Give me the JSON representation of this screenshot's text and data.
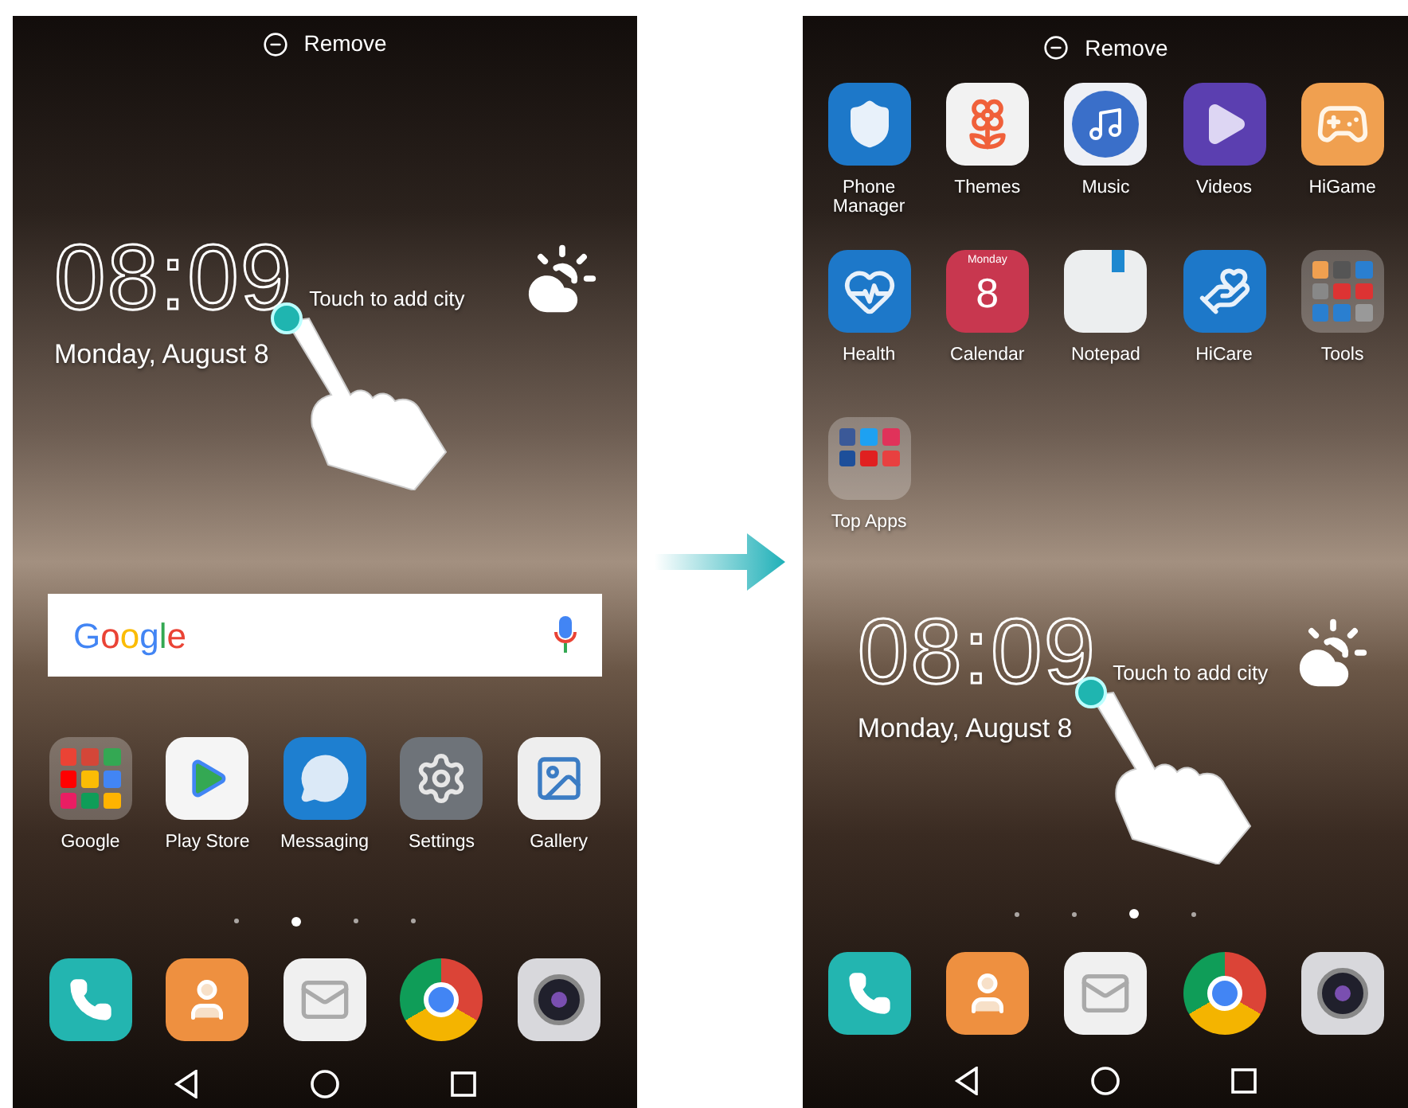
{
  "screens": [
    {
      "remove": "Remove",
      "sections": [
        {
          "kind": "clock",
          "time": "08:09",
          "hint": "Touch to add city",
          "date": "Monday, August 8"
        },
        {
          "kind": "search",
          "logo": "Google"
        },
        {
          "kind": "apps",
          "apps": [
            {
              "label": "Google"
            },
            {
              "label": "Play Store"
            },
            {
              "label": "Messaging"
            },
            {
              "label": "Settings"
            },
            {
              "label": "Gallery"
            }
          ]
        }
      ],
      "pages": [
        {
          "selected": false
        },
        {
          "selected": true
        },
        {
          "selected": false
        },
        {
          "selected": false
        }
      ]
    },
    {
      "remove": "Remove",
      "sections": [
        {
          "kind": "apps",
          "apps": [
            {
              "label": "Phone Manager"
            },
            {
              "label": "Themes"
            },
            {
              "label": "Music"
            },
            {
              "label": "Videos"
            },
            {
              "label": "HiGame"
            },
            {
              "label": "Health"
            },
            {
              "label": "Calendar",
              "icon_text": {
                "day": "Monday",
                "date": "8"
              }
            },
            {
              "label": "Notepad"
            },
            {
              "label": "HiCare"
            },
            {
              "label": "Tools"
            },
            {
              "label": "Top Apps"
            }
          ]
        },
        {
          "kind": "clock",
          "time": "08:09",
          "hint": "Touch to add city",
          "date": "Monday, August 8"
        }
      ],
      "pages": [
        {
          "selected": false
        },
        {
          "selected": false
        },
        {
          "selected": true
        },
        {
          "selected": false
        }
      ]
    }
  ]
}
